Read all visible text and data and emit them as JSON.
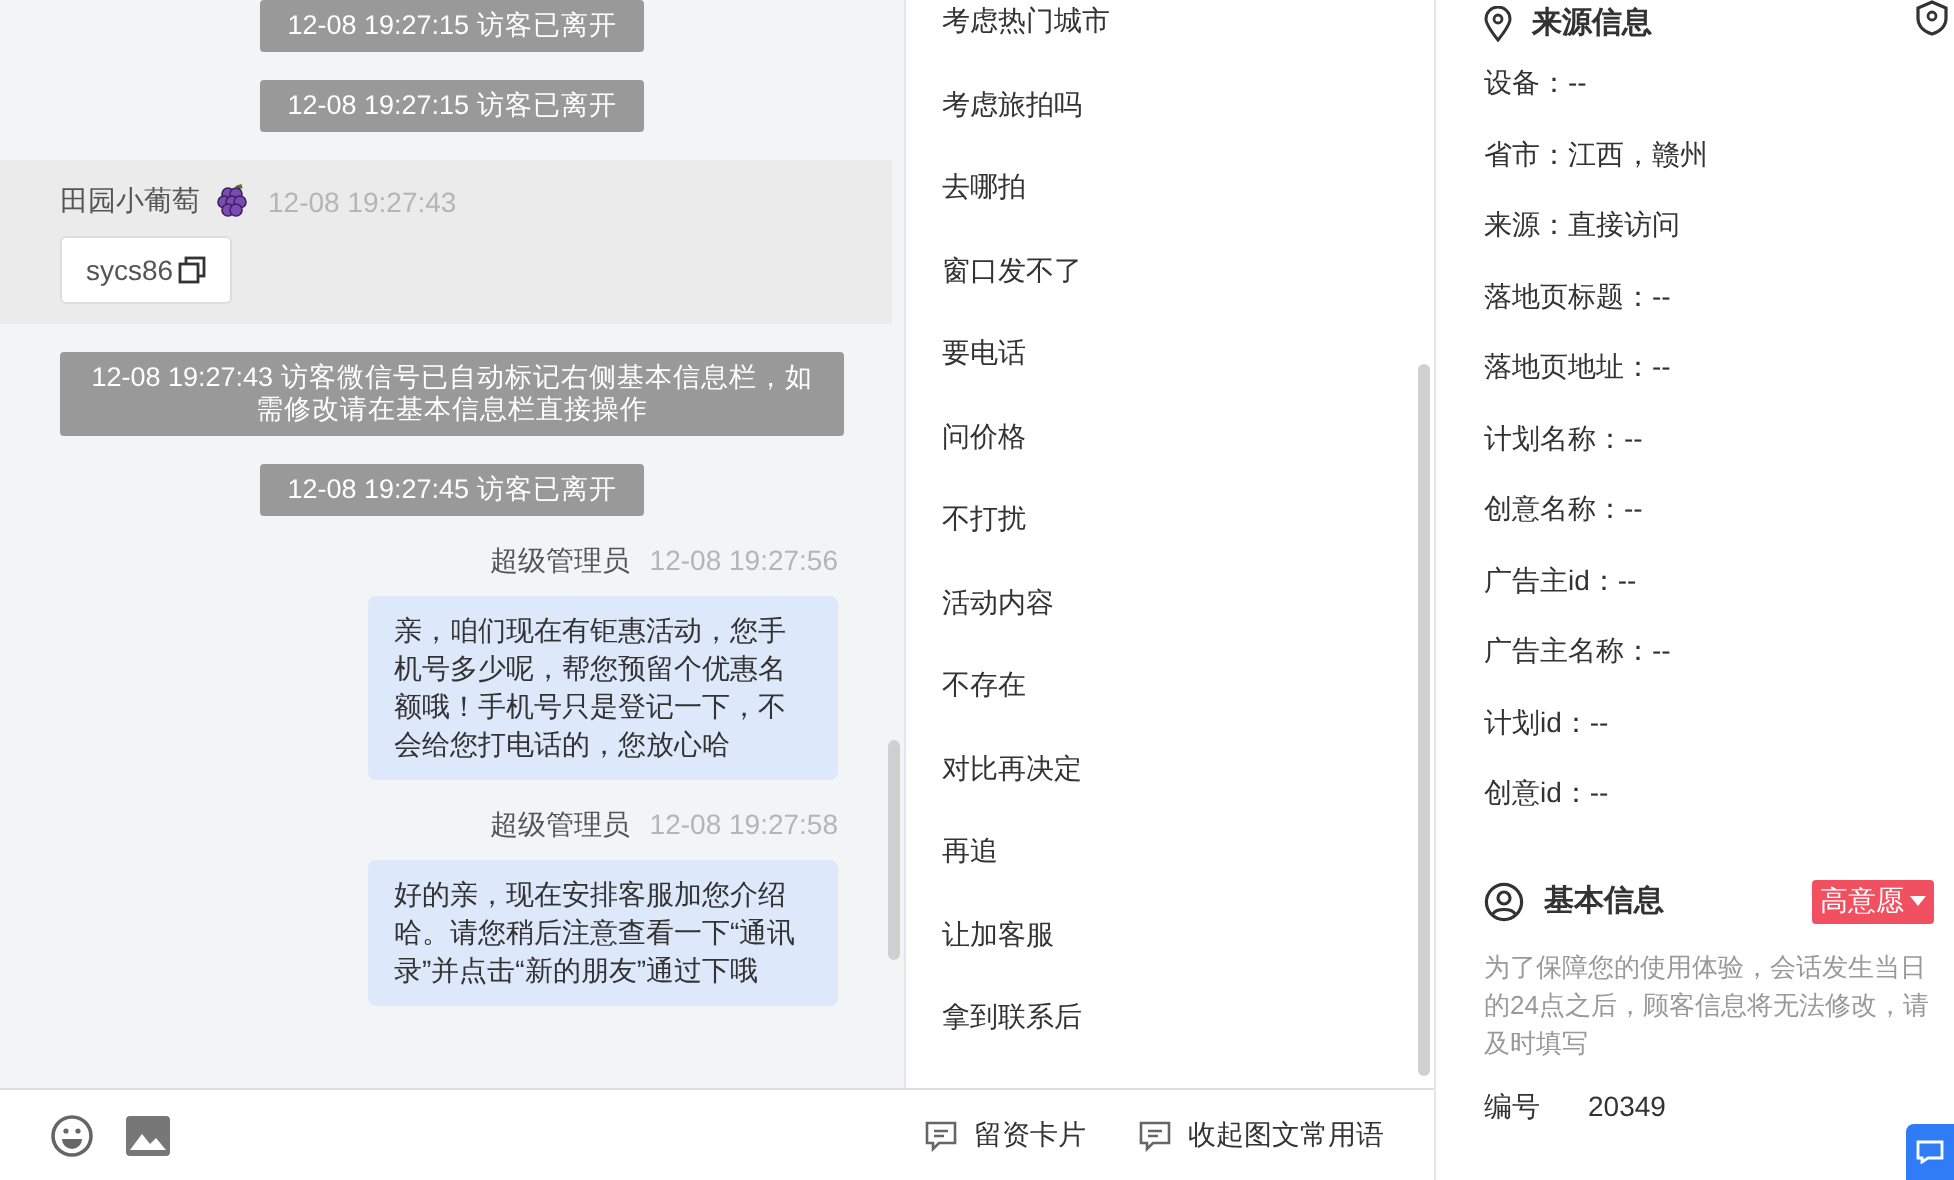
{
  "chat": {
    "messages": [
      {
        "kind": "system",
        "text": "12-08 19:27:15 访客已离开"
      },
      {
        "kind": "system",
        "text": "12-08 19:27:15 访客已离开"
      },
      {
        "kind": "visitor",
        "name": "田园小葡萄",
        "time": "12-08 19:27:43",
        "text": "sycs86"
      },
      {
        "kind": "system",
        "text": "12-08 19:27:43 访客微信号已自动标记右侧基本信息栏，如需修改请在基本信息栏直接操作"
      },
      {
        "kind": "system",
        "text": "12-08 19:27:45 访客已离开"
      },
      {
        "kind": "agent",
        "name": "超级管理员",
        "time": "12-08 19:27:56",
        "text": "亲，咱们现在有钜惠活动，您手机号多少呢，帮您预留个优惠名额哦！手机号只是登记一下，不会给您打电话的，您放心哈"
      },
      {
        "kind": "agent",
        "name": "超级管理员",
        "time": "12-08 19:27:58",
        "text": "好的亲，现在安排客服加您介绍哈。请您稍后注意查看一下“通讯录”并点击“新的朋友”通过下哦"
      }
    ]
  },
  "phrases": [
    "考虑热门城市",
    "考虑旅拍吗",
    "去哪拍",
    "窗口发不了",
    "要电话",
    "问价格",
    "不打扰",
    "活动内容",
    "不存在",
    "对比再决定",
    "再追",
    "让加客服",
    "拿到联系后"
  ],
  "toolbar": {
    "buttons": [
      "留资卡片",
      "收起图文常用语"
    ]
  },
  "source_info": {
    "title": "来源信息",
    "rows": [
      "设备：--",
      "省市：江西，赣州",
      "来源：直接访问",
      "落地页标题：--",
      "落地页地址：--",
      "计划名称：--",
      "创意名称：--",
      "广告主id：--",
      "广告主名称：--",
      "计划id：--",
      "创意id：--"
    ]
  },
  "basic_info": {
    "title": "基本信息",
    "tag": {
      "label": "高意愿",
      "color": "#f0505f"
    },
    "notice": "为了保障您的使用体验，会话发生当日的24点之后，顾客信息将无法修改，请及时填写",
    "fields": [
      {
        "label": "编号",
        "value": "20349"
      }
    ]
  }
}
